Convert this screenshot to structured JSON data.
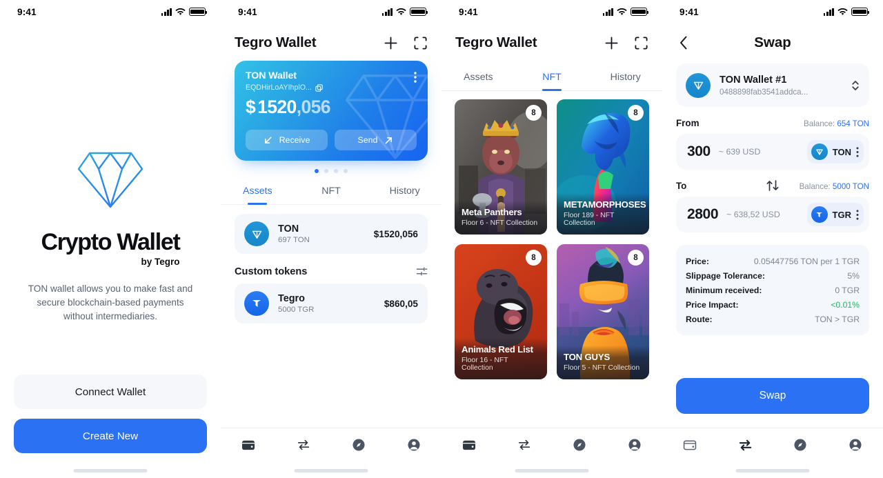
{
  "status_bar": {
    "time": "9:41",
    "icons": [
      "signal-bars-icon",
      "wifi-icon",
      "battery-icon"
    ]
  },
  "colors": {
    "accent": "#2a71f4",
    "card_gradient_start": "#32c2e8",
    "card_gradient_end": "#1763f0",
    "positive": "#27ae60"
  },
  "screen_onboarding": {
    "logo": "diamond-logo",
    "brand_title": "Crypto Wallet",
    "brand_subtitle": "by Tegro",
    "tagline": "TON wallet allows you to make fast and secure blockchain-based payments without intermediaries.",
    "secondary_button": "Connect Wallet",
    "primary_button": "Create New"
  },
  "screen_assets": {
    "header_title": "Tegro Wallet",
    "header_actions": [
      "plus-icon",
      "scan-qr-icon"
    ],
    "wallet_card": {
      "name": "TON Wallet",
      "address": "EQDHirLoAYIhplO...",
      "currency_symbol": "$",
      "amount_main": "1520",
      "amount_cents": ",056",
      "receive_label": "Receive",
      "send_label": "Send",
      "menu_icon": "more-vertical-icon"
    },
    "pagination": {
      "total": 4,
      "active_index": 0
    },
    "tabs": [
      {
        "label": "Assets",
        "active": true
      },
      {
        "label": "NFT",
        "active": false
      },
      {
        "label": "History",
        "active": false
      }
    ],
    "assets": [
      {
        "icon": "ton-coin-icon",
        "name": "TON",
        "amount": "697 TON",
        "value": "$1520,056"
      }
    ],
    "custom_tokens_title": "Custom tokens",
    "custom_tokens_filter_icon": "sliders-icon",
    "custom_tokens": [
      {
        "icon": "tegro-coin-icon",
        "name": "Tegro",
        "amount": "5000 TGR",
        "value": "$860,05"
      }
    ]
  },
  "screen_nft": {
    "header_title": "Tegro Wallet",
    "header_actions": [
      "plus-icon",
      "scan-qr-icon"
    ],
    "tabs": [
      {
        "label": "Assets",
        "active": false
      },
      {
        "label": "NFT",
        "active": true
      },
      {
        "label": "History",
        "active": false
      }
    ],
    "nfts": [
      {
        "title": "Meta Panthers",
        "subtitle": "Floor 6 - NFT Collection",
        "badge": "8",
        "art": "panther-king"
      },
      {
        "title": "METAMORPHOSES",
        "subtitle": "Floor 189 - NFT Collection",
        "badge": "8",
        "art": "iridescent-figure"
      },
      {
        "title": "Animals Red List",
        "subtitle": "Floor 16 - NFT Collection",
        "badge": "8",
        "art": "roaring-gorilla"
      },
      {
        "title": "TON GUYS",
        "subtitle": "Floor 5 - NFT Collection",
        "badge": "8",
        "art": "visor-guy"
      }
    ]
  },
  "screen_swap": {
    "back_icon": "chevron-left-icon",
    "title": "Swap",
    "wallet": {
      "name": "TON Wallet #1",
      "address": "0488898fab3541addca...",
      "icon": "ton-coin-icon",
      "selector_icon": "chevron-updown-icon"
    },
    "from": {
      "label": "From",
      "balance_label": "Balance:",
      "balance_value": "654 TON",
      "amount": "300",
      "usd": "~ 639 USD",
      "token": "TON",
      "token_icon": "ton-coin-icon",
      "menu_icon": "more-vertical-icon"
    },
    "switch_icon": "swap-vertical-icon",
    "to": {
      "label": "To",
      "balance_label": "Balance:",
      "balance_value": "5000 TON",
      "amount": "2800",
      "usd": "~ 638,52 USD",
      "token": "TGR",
      "token_icon": "tegro-coin-icon",
      "menu_icon": "more-vertical-icon"
    },
    "details": [
      {
        "key": "Price:",
        "value": "0.05447756 TON per 1 TGR",
        "tone": "normal"
      },
      {
        "key": "Slippage Tolerance:",
        "value": "5%",
        "tone": "normal"
      },
      {
        "key": "Minimum received:",
        "value": "0 TGR",
        "tone": "normal"
      },
      {
        "key": "Price Impact:",
        "value": "<0.01%",
        "tone": "green"
      },
      {
        "key": "Route:",
        "value": "TON > TGR",
        "tone": "normal"
      }
    ],
    "cta_label": "Swap"
  },
  "tabbar": {
    "items": [
      {
        "icon": "wallet-icon",
        "name": "wallet"
      },
      {
        "icon": "swap-icon",
        "name": "swap"
      },
      {
        "icon": "compass-icon",
        "name": "explore"
      },
      {
        "icon": "profile-icon",
        "name": "profile"
      }
    ]
  }
}
